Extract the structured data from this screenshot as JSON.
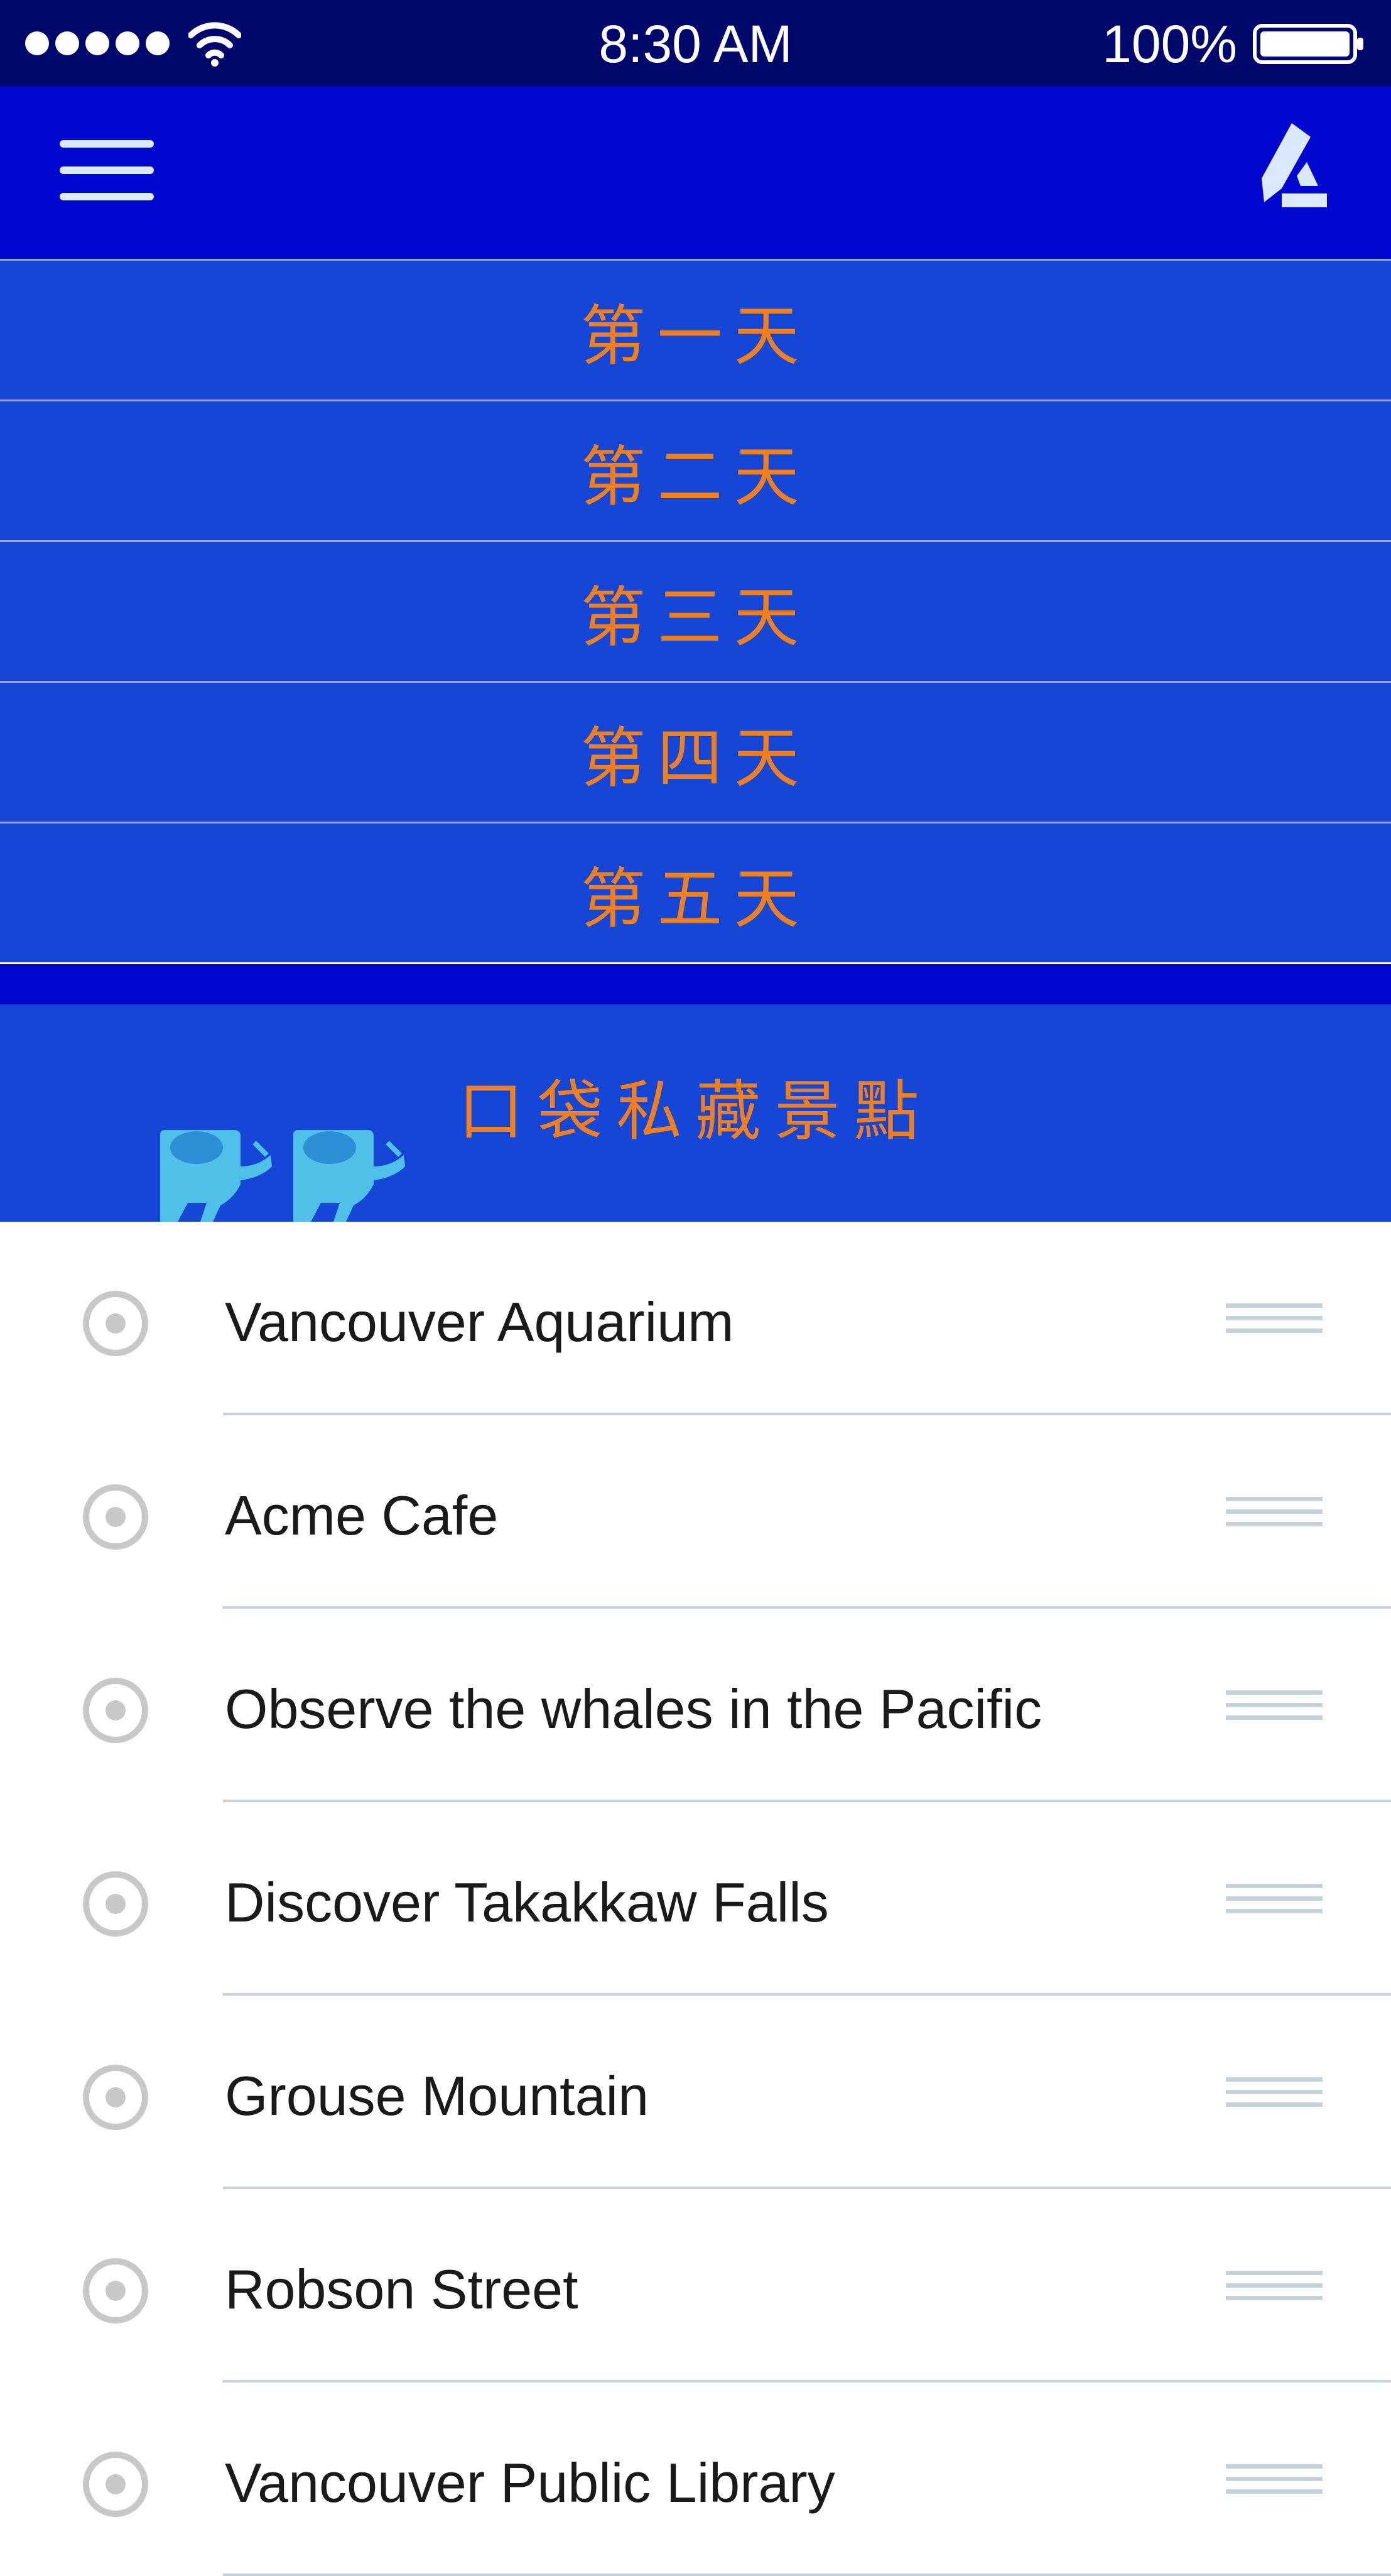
{
  "status_bar": {
    "time": "8:30 AM",
    "battery_percent": "100%",
    "signal_dots": 5,
    "icons": [
      "signal-dots-icon",
      "wifi-icon",
      "battery-icon"
    ]
  },
  "nav_bar": {
    "menu_icon": "hamburger-menu-icon",
    "edit_icon": "edit-pen-icon",
    "background": "#0007cf"
  },
  "days": [
    {
      "label": "第一天"
    },
    {
      "label": "第二天"
    },
    {
      "label": "第三天"
    },
    {
      "label": "第四天"
    },
    {
      "label": "第五天"
    }
  ],
  "hidden_spots": {
    "label": "口袋私藏景點",
    "decoration_icon": "whale-icon"
  },
  "spots": [
    {
      "name": "Vancouver Aquarium"
    },
    {
      "name": "Acme Cafe"
    },
    {
      "name": "Observe the whales in the Pacific"
    },
    {
      "name": "Discover Takakkaw Falls"
    },
    {
      "name": "Grouse Mountain"
    },
    {
      "name": "Robson Street"
    },
    {
      "name": "Vancouver Public Library"
    }
  ],
  "colors": {
    "status_bar": "#00086b",
    "day_row": "#1546d6",
    "accent_text": "#f07f1d",
    "divider": "#c2d1dd"
  }
}
